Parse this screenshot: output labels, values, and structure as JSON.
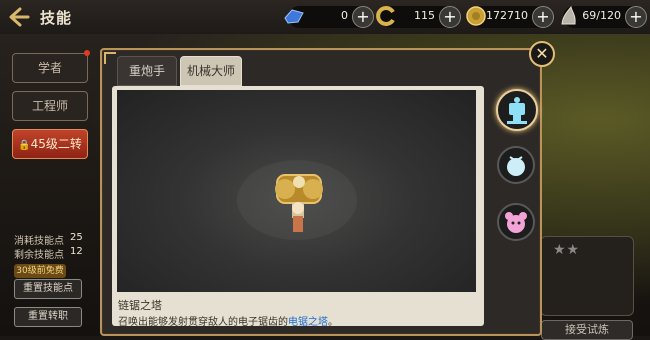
{
  "header": {
    "title": "技能",
    "resources": [
      {
        "name": "blue-gem",
        "value": "0",
        "color": "#3f78d8"
      },
      {
        "name": "gold-swirl",
        "value": "115",
        "color": "#c6a23a"
      },
      {
        "name": "gold-coin",
        "value": "172710",
        "color": "#c9a033"
      },
      {
        "name": "stamina",
        "value": "69/120",
        "color": "#b9b4aa"
      }
    ]
  },
  "sidebar": {
    "items": [
      {
        "label": "学者"
      },
      {
        "label": "工程师"
      },
      {
        "label": "45级二转"
      }
    ],
    "stats": [
      {
        "label": "消耗技能点",
        "value": "25"
      },
      {
        "label": "剩余技能点",
        "value": "12"
      }
    ],
    "free_badge": "30级前免费",
    "reset_button": "重置技能点",
    "reset_job_button": "重置转职"
  },
  "modal": {
    "tabs": [
      {
        "label": "重炮手",
        "active": false
      },
      {
        "label": "机械大师",
        "active": true
      }
    ],
    "skill": {
      "name": "链锯之塔",
      "desc_prefix": "召唤出能够发射贯穿敌人的电子锯齿的",
      "desc_highlight": "电锯之塔",
      "desc_suffix": "。"
    },
    "close_icon": "close-icon"
  },
  "right_panel": {
    "accept_button": "接受试炼"
  },
  "colors": {
    "accent_gold": "#b8945a",
    "active_red": "#c0432a",
    "highlight_blue": "#1a6cd0"
  }
}
